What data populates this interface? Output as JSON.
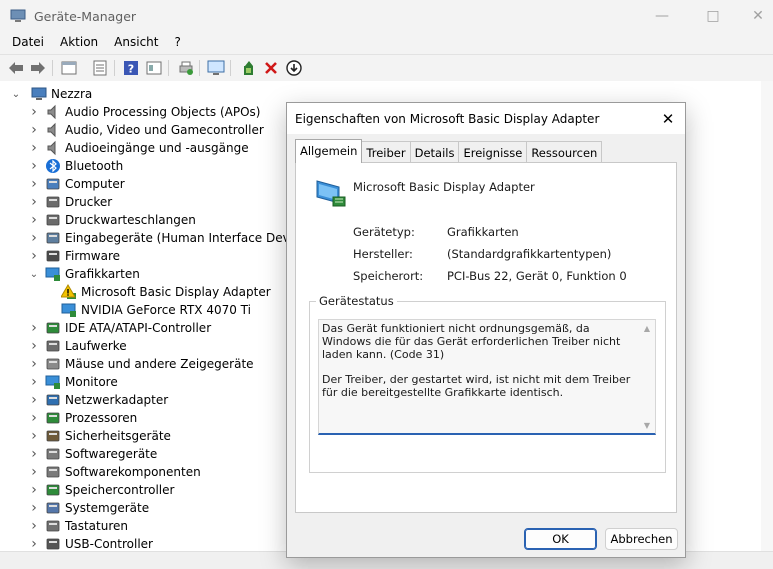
{
  "window": {
    "title": "Geräte-Manager"
  },
  "menu": [
    "Datei",
    "Aktion",
    "Ansicht",
    "?"
  ],
  "tree": {
    "root": "Nezzra",
    "items": [
      {
        "label": "Audio Processing Objects (APOs)",
        "icon": "speaker-icon",
        "expanded": false
      },
      {
        "label": "Audio, Video und Gamecontroller",
        "icon": "speaker-icon",
        "expanded": false
      },
      {
        "label": "Audioeingänge und -ausgänge",
        "icon": "speaker-icon",
        "expanded": false
      },
      {
        "label": "Bluetooth",
        "icon": "bluetooth-icon",
        "expanded": false
      },
      {
        "label": "Computer",
        "icon": "computer-icon",
        "expanded": false
      },
      {
        "label": "Drucker",
        "icon": "printer-icon",
        "expanded": false
      },
      {
        "label": "Druckwarteschlangen",
        "icon": "printer-icon",
        "expanded": false
      },
      {
        "label": "Eingabegeräte (Human Interface Devices)",
        "icon": "hid-icon",
        "expanded": false
      },
      {
        "label": "Firmware",
        "icon": "chip-icon",
        "expanded": false
      },
      {
        "label": "Grafikkarten",
        "icon": "display-adapter-icon",
        "expanded": true
      },
      {
        "label": "Microsoft Basic Display Adapter",
        "icon": "warning-icon",
        "child": true
      },
      {
        "label": "NVIDIA GeForce RTX 4070 Ti",
        "icon": "display-adapter-icon",
        "child": true
      },
      {
        "label": "IDE ATA/ATAPI-Controller",
        "icon": "controller-icon",
        "expanded": false
      },
      {
        "label": "Laufwerke",
        "icon": "drive-icon",
        "expanded": false
      },
      {
        "label": "Mäuse und andere Zeigegeräte",
        "icon": "mouse-icon",
        "expanded": false
      },
      {
        "label": "Monitore",
        "icon": "monitor-icon",
        "expanded": false
      },
      {
        "label": "Netzwerkadapter",
        "icon": "network-icon",
        "expanded": false
      },
      {
        "label": "Prozessoren",
        "icon": "cpu-icon",
        "expanded": false
      },
      {
        "label": "Sicherheitsgeräte",
        "icon": "security-icon",
        "expanded": false
      },
      {
        "label": "Softwaregeräte",
        "icon": "software-icon",
        "expanded": false
      },
      {
        "label": "Softwarekomponenten",
        "icon": "software-icon",
        "expanded": false
      },
      {
        "label": "Speichercontroller",
        "icon": "storage-icon",
        "expanded": false
      },
      {
        "label": "Systemgeräte",
        "icon": "system-icon",
        "expanded": false
      },
      {
        "label": "Tastaturen",
        "icon": "keyboard-icon",
        "expanded": false
      },
      {
        "label": "USB-Controller",
        "icon": "usb-icon",
        "expanded": false
      }
    ]
  },
  "dialog": {
    "title": "Eigenschaften von Microsoft Basic Display Adapter",
    "tabs": [
      "Allgemein",
      "Treiber",
      "Details",
      "Ereignisse",
      "Ressourcen"
    ],
    "device_name": "Microsoft Basic Display Adapter",
    "properties": [
      {
        "label": "Gerätetyp:",
        "value": "Grafikkarten"
      },
      {
        "label": "Hersteller:",
        "value": "(Standardgrafikkartentypen)"
      },
      {
        "label": "Speicherort:",
        "value": "PCI-Bus 22, Gerät 0, Funktion 0"
      }
    ],
    "status_group_label": "Gerätestatus",
    "status_text_1": "Das Gerät funktioniert nicht ordnungsgemäß, da Windows die für das Gerät erforderlichen Treiber nicht laden kann. (Code 31)",
    "status_text_2": "Der Treiber, der gestartet wird, ist nicht mit dem Treiber für die bereitgestellte Grafikkarte identisch.",
    "ok_label": "OK",
    "cancel_label": "Abbrechen"
  },
  "colors": {
    "accent": "#2a62b2",
    "warning": "#f2c200",
    "delete": "#d01818"
  }
}
